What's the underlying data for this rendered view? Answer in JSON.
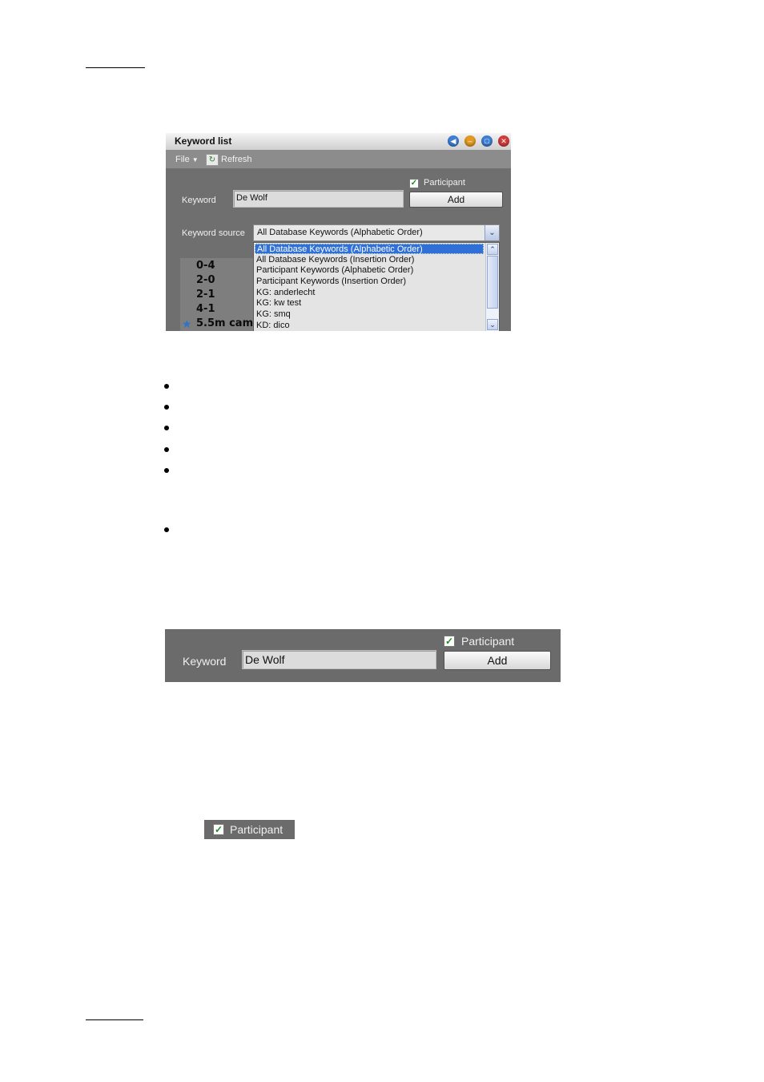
{
  "window": {
    "title": "Keyword list",
    "menu": {
      "file": "File",
      "refresh": "Refresh"
    },
    "participant_label": "Participant",
    "participant_checked": true,
    "keyword_label": "Keyword",
    "keyword_value": "De Wolf",
    "add_label": "Add",
    "source_label": "Keyword source",
    "source_selected": "All Database Keywords (Alphabetic Order)",
    "dropdown_options": [
      "All Database Keywords (Alphabetic Order)",
      "All Database Keywords (Insertion Order)",
      "Participant Keywords (Alphabetic Order)",
      "Participant Keywords (Insertion Order)",
      "KG: anderlecht",
      "KG: kw test",
      "KG: smq",
      "KD: dico"
    ],
    "background_scores": [
      "0-4",
      "2-0",
      "2-1",
      "4-1",
      "5.5m cam"
    ]
  },
  "panel2": {
    "participant_label": "Participant",
    "keyword_label": "Keyword",
    "keyword_value": "De Wolf",
    "add_label": "Add"
  },
  "chip": {
    "participant_label": "Participant"
  }
}
